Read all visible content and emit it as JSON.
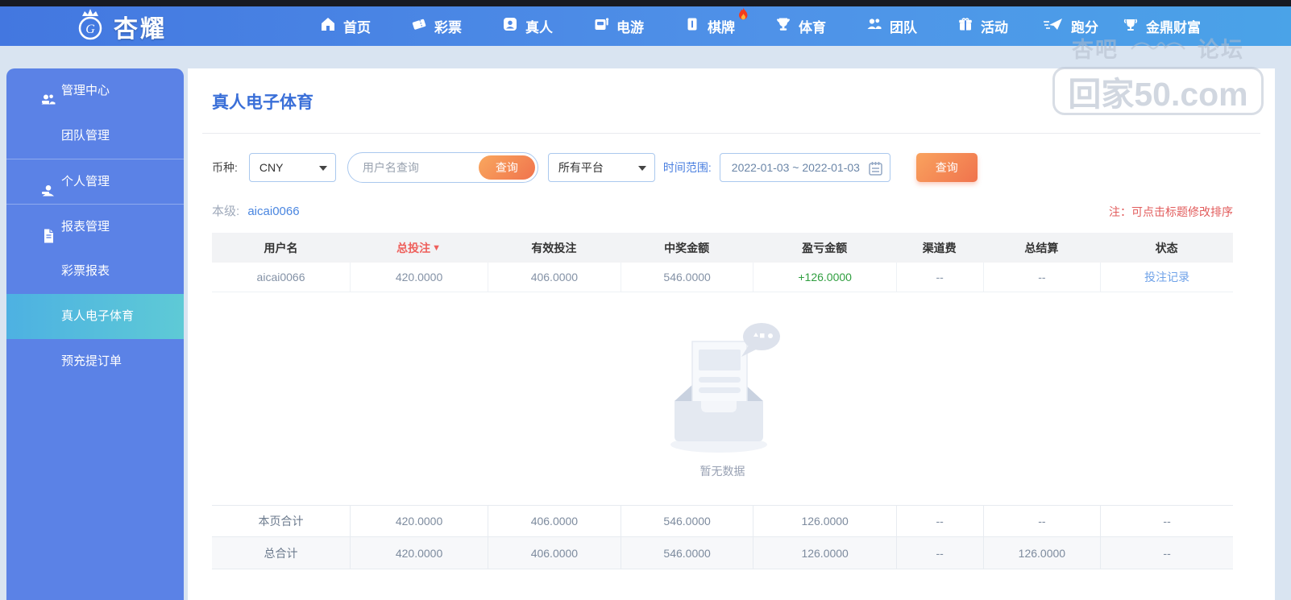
{
  "brand": {
    "name": "杏耀"
  },
  "nav": {
    "items": [
      {
        "label": "首页",
        "icon": "home-icon"
      },
      {
        "label": "彩票",
        "icon": "lottery-ticket-icon"
      },
      {
        "label": "真人",
        "icon": "live-person-icon"
      },
      {
        "label": "电游",
        "icon": "slot-machine-icon"
      },
      {
        "label": "棋牌",
        "icon": "mahjong-tile-icon",
        "badge": "flame-icon"
      },
      {
        "label": "体育",
        "icon": "trophy-icon"
      },
      {
        "label": "团队",
        "icon": "team-icon"
      },
      {
        "label": "活动",
        "icon": "gift-icon"
      },
      {
        "label": "跑分",
        "icon": "racing-icon"
      },
      {
        "label": "金鼎财富",
        "icon": "golden-cauldron-icon"
      }
    ]
  },
  "watermark": {
    "left_text": "杏吧",
    "right_text": "论坛",
    "box_text": "回家50.com"
  },
  "sidebar": {
    "items": [
      {
        "label": "管理中心",
        "type": "section",
        "icon": "users-icon"
      },
      {
        "label": "团队管理",
        "type": "sub"
      },
      {
        "label": "个人管理",
        "type": "section",
        "icon": "user-icon"
      },
      {
        "label": "报表管理",
        "type": "section",
        "icon": "report-icon"
      },
      {
        "label": "彩票报表",
        "type": "sub"
      },
      {
        "label": "真人电子体育",
        "type": "sub",
        "active": true
      },
      {
        "label": "预充提订单",
        "type": "sub"
      }
    ]
  },
  "page": {
    "title": "真人电子体育",
    "filters": {
      "currency_label": "币种:",
      "currency_value": "CNY",
      "username_placeholder": "用户名查询",
      "username_search_button": "查询",
      "platform_value": "所有平台",
      "date_label": "时间范围:",
      "date_value": "2022-01-03 ~ 2022-01-03",
      "query_button": "查询"
    },
    "level": {
      "label": "本级:",
      "username": "aicai0066"
    },
    "note": "注：可点击标题修改排序",
    "table": {
      "columns": [
        "用户名",
        "总投注",
        "有效投注",
        "中奖金额",
        "盈亏金额",
        "渠道费",
        "总结算",
        "状态"
      ],
      "sorted_column": "总投注",
      "sort_indicator": "▼",
      "rows": [
        [
          "aicai0066",
          "420.0000",
          "406.0000",
          "546.0000",
          "+126.0000",
          "--",
          "--",
          "投注记录"
        ]
      ],
      "empty_text": "暂无数据",
      "page_total": [
        "本页合计",
        "420.0000",
        "406.0000",
        "546.0000",
        "126.0000",
        "--",
        "--",
        "--"
      ],
      "grand_total": [
        "总合计",
        "420.0000",
        "406.0000",
        "546.0000",
        "126.0000",
        "--",
        "126.0000",
        "--"
      ]
    }
  },
  "colors": {
    "top_strip": "#171a22",
    "nav_gradient_start": "#4377e0",
    "nav_gradient_end": "#4aa3e8",
    "sidebar_bg": "#5b82e6",
    "active_item_start": "#4db1e2",
    "active_item_end": "#5ecad6",
    "accent_blue": "#3a6fd8",
    "orange_start": "#f9a25e",
    "orange_end": "#f0734d",
    "profit_green": "#2f9e3f",
    "alert_red": "#e25c5c",
    "page_bg": "#d9e4f1"
  }
}
